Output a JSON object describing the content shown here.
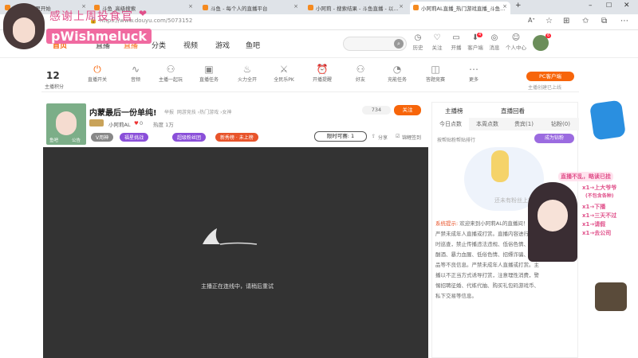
{
  "browser": {
    "tabs": [
      {
        "label": "hacl... 达里开始"
      },
      {
        "label": "斗鱼_高级搜索"
      },
      {
        "label": "斗鱼 - 每个人的直播平台"
      },
      {
        "label": "小阿莉 - 搜索结果 - 斗鱼直播 - 以..."
      },
      {
        "label": "小阿莉AL直播_热门游戏直播_斗鱼..."
      }
    ],
    "url": "https://www.douyu.com/5073152"
  },
  "overlay": {
    "title": "感谢上周投食官",
    "name": "pWishmeluck"
  },
  "site": {
    "nav": [
      "首页",
      "直播",
      "分类",
      "视频",
      "游戏",
      "鱼吧"
    ],
    "search_placeholder": "",
    "header_icons": [
      {
        "label": "历史",
        "icon": "clock-icon"
      },
      {
        "label": "关注",
        "icon": "heart-icon"
      },
      {
        "label": "开播",
        "icon": "video-icon"
      },
      {
        "label": "客户端",
        "icon": "download-icon",
        "badge": "4"
      },
      {
        "label": "消息",
        "icon": "bell-icon"
      },
      {
        "label": "个人中心",
        "icon": "user-icon"
      }
    ]
  },
  "quickbar": {
    "score_value": "12",
    "score_label": "主播积分",
    "items": [
      {
        "label": "直播开关",
        "icon": "power-icon"
      },
      {
        "label": "音频",
        "icon": "audio-icon"
      },
      {
        "label": "主播一起玩",
        "icon": "people-icon"
      },
      {
        "label": "直播任务",
        "icon": "task-icon"
      },
      {
        "label": "火力全开",
        "icon": "fire-icon"
      },
      {
        "label": "全民乐PK",
        "icon": "pk-icon"
      },
      {
        "label": "开播提醒",
        "icon": "alarm-icon"
      },
      {
        "label": "好友",
        "icon": "friend-icon"
      },
      {
        "label": "充能任务",
        "icon": "charge-icon"
      },
      {
        "label": "答题竞赛",
        "icon": "quiz-icon"
      },
      {
        "label": "更多",
        "icon": "more-icon"
      }
    ],
    "pc_button": "PC客户端",
    "pc_sub": "主播创建已上线"
  },
  "room": {
    "title": "内蒙最后一份单纯!",
    "breadcrumb": [
      "举报",
      "网游竞技",
      "热门游戏",
      "女神"
    ],
    "streamer": "小阿莉AL",
    "fans": "0",
    "heat": "热度 1万",
    "follow_count": "734",
    "follow_label": "关注",
    "level_badge": "V用神",
    "pills": [
      "福星挑战",
      "超级粉丝团",
      "新秀榜 · 未上榜"
    ],
    "limited": "限时可赛: 1",
    "share": "分享",
    "report": "锦鲤签到",
    "avatar_caption": [
      "鱼吧",
      "公告"
    ]
  },
  "player": {
    "status": "主播正在连线中，请稍后重试"
  },
  "rightpanel": {
    "top_tabs": [
      "主播榜",
      "直播回看"
    ],
    "rank_tabs": [
      "今日点数",
      "本周点数",
      "贵宾(1)",
      "钻粉(0)"
    ],
    "subtitle": "按帮贴粉帮贴排行",
    "become_fan": "成为钻粉",
    "empty_text": "还未有粉丝上榜",
    "system_label": "系统提示:",
    "system_text": "欢迎来到小阿莉AL的直播间！斗鱼严禁未成年人直播或打赏。直播内容进行24小时巡查，禁止传播违法违规、低俗色情、吸烟酗酒、暴力血腥、低俗色情、招嫖诈骗、违禁品等不良信息。严禁未成年人直播或打赏。主播以不正当方式诱导打赏，注意理性消费，警惕招聘征婚、代练代抽、购买礼包码游戏币、私下交易等信息。"
  },
  "side_stickers": {
    "heading": "直播不乱，略读已挂",
    "lines": [
      "x1→上大爷爷",
      "(不包含各种)",
      "x1→下播",
      "x1→三天不过",
      "x1→请假",
      "x1→去公司"
    ]
  },
  "colors": {
    "accent": "#f7650a",
    "pink": "#e0508a",
    "player_bg": "#333333"
  }
}
